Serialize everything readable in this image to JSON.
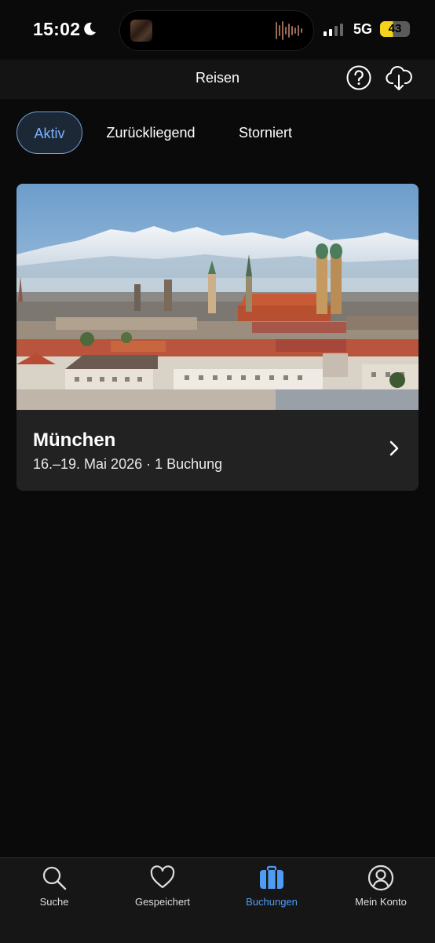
{
  "status_bar": {
    "time": "15:02",
    "network": "5G",
    "battery": "43"
  },
  "header": {
    "title": "Reisen",
    "help_icon": "question-circle-icon",
    "download_icon": "cloud-download-icon"
  },
  "tabs": [
    {
      "label": "Aktiv",
      "active": true
    },
    {
      "label": "Zurückliegend",
      "active": false
    },
    {
      "label": "Storniert",
      "active": false
    }
  ],
  "trip": {
    "city": "München",
    "details": "16.–19. Mai 2026 · 1 Buchung",
    "image": "munich-skyline-alps-photo"
  },
  "nav": [
    {
      "label": "Suche",
      "icon": "search-icon",
      "active": false
    },
    {
      "label": "Gespeichert",
      "icon": "heart-icon",
      "active": false
    },
    {
      "label": "Buchungen",
      "icon": "suitcase-icon",
      "active": true
    },
    {
      "label": "Mein Konto",
      "icon": "user-circle-icon",
      "active": false
    }
  ],
  "colors": {
    "background": "#0a0a0a",
    "accent": "#4f9cf5",
    "battery": "#f5d31b"
  }
}
